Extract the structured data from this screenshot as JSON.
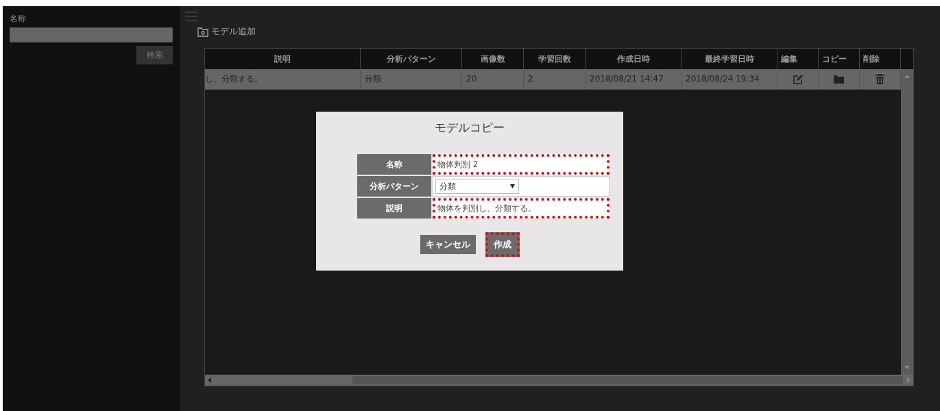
{
  "sidebar": {
    "name_label": "名称",
    "search_button": "検索"
  },
  "toolbar": {
    "add_model": "モデル追加"
  },
  "table": {
    "columns": [
      "説明",
      "分析パターン",
      "画像数",
      "学習回数",
      "作成日時",
      "最終学習日時",
      "編集",
      "コピー",
      "削除"
    ],
    "rows": [
      {
        "description": "し、分類する。",
        "pattern": "分類",
        "images": "20",
        "training_count": "2",
        "created": "2018/08/21 14:47",
        "last_trained": "2018/08/24 19:34",
        "selected": true
      }
    ]
  },
  "dialog": {
    "title": "モデルコピー",
    "fields": [
      {
        "kind": "text",
        "label": "名称",
        "value": "物体判別 2",
        "highlighted": true
      },
      {
        "kind": "select",
        "label": "分析パターン",
        "value": "分類",
        "highlighted": false
      },
      {
        "kind": "text",
        "label": "説明",
        "value": "物体を判別し、分類する。",
        "highlighted": true
      }
    ],
    "buttons": [
      {
        "label": "キャンセル",
        "highlighted": false
      },
      {
        "label": "作成",
        "highlighted": true
      }
    ]
  }
}
